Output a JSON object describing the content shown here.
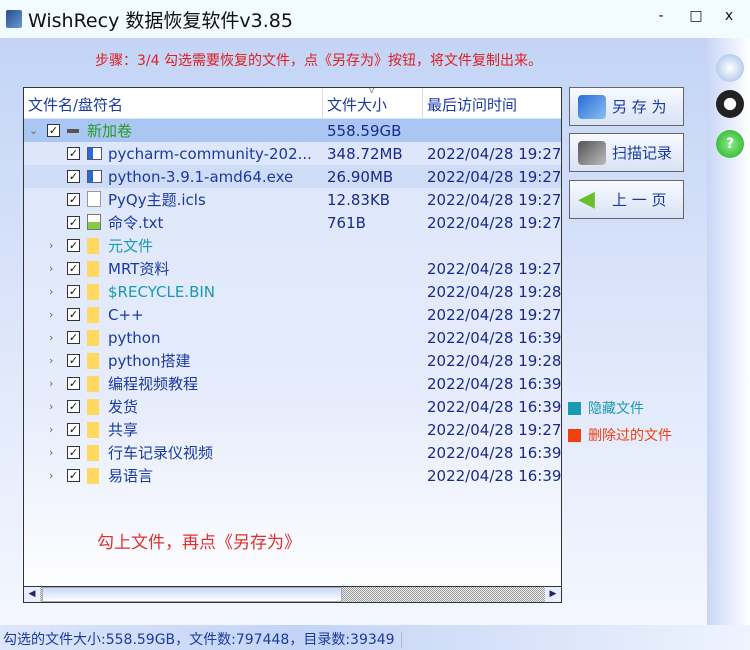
{
  "window": {
    "title": "WishRecy 数据恢复软件v3.85",
    "minimize": "-",
    "maximize": "□",
    "close": "x"
  },
  "step_text": "步骤：3/4 勾选需要恢复的文件，点《另存为》按钮，将文件复制出来。",
  "columns": {
    "name": "文件名/盘符名",
    "size": "文件大小",
    "time": "最后访问时间"
  },
  "rows": [
    {
      "name": "新加卷",
      "size": "558.59GB",
      "time": "",
      "level": 0,
      "type": "drive",
      "expanded": true,
      "checked": true,
      "color": "#2a9a2a"
    },
    {
      "name": "pycharm-community-202...",
      "size": "348.72MB",
      "time": "2022/04/28 19:27:",
      "level": 1,
      "type": "exe",
      "checked": true,
      "color": "#1a3aa0"
    },
    {
      "name": "python-3.9.1-amd64.exe",
      "size": "26.90MB",
      "time": "2022/04/28 19:27:",
      "level": 1,
      "type": "exe",
      "checked": true,
      "color": "#1a3aa0"
    },
    {
      "name": "PyQy主题.icls",
      "size": "12.83KB",
      "time": "2022/04/28 19:27:",
      "level": 1,
      "type": "file",
      "checked": true,
      "color": "#1a3aa0"
    },
    {
      "name": "命令.txt",
      "size": "761B",
      "time": "2022/04/28 19:27:",
      "level": 1,
      "type": "txt",
      "checked": true,
      "color": "#1a3aa0"
    },
    {
      "name": "元文件",
      "size": "",
      "time": "",
      "level": 1,
      "type": "folder",
      "checked": true,
      "color": "#1a9ab0"
    },
    {
      "name": "MRT资料",
      "size": "",
      "time": "2022/04/28 19:27:",
      "level": 1,
      "type": "folder",
      "checked": true,
      "color": "#1a3aa0"
    },
    {
      "name": "$RECYCLE.BIN",
      "size": "",
      "time": "2022/04/28 19:28:",
      "level": 1,
      "type": "folder",
      "checked": true,
      "color": "#1a9ab0"
    },
    {
      "name": "C++",
      "size": "",
      "time": "2022/04/28 19:27:",
      "level": 1,
      "type": "folder",
      "checked": true,
      "color": "#1a3aa0"
    },
    {
      "name": "python",
      "size": "",
      "time": "2022/04/28 16:39:",
      "level": 1,
      "type": "folder",
      "checked": true,
      "color": "#1a3aa0"
    },
    {
      "name": "python搭建",
      "size": "",
      "time": "2022/04/28 19:28:",
      "level": 1,
      "type": "folder",
      "checked": true,
      "color": "#1a3aa0"
    },
    {
      "name": "编程视频教程",
      "size": "",
      "time": "2022/04/28 16:39:",
      "level": 1,
      "type": "folder",
      "checked": true,
      "color": "#1a3aa0"
    },
    {
      "name": "发货",
      "size": "",
      "time": "2022/04/28 16:39:",
      "level": 1,
      "type": "folder",
      "checked": true,
      "color": "#1a3aa0"
    },
    {
      "name": "共享",
      "size": "",
      "time": "2022/04/28 19:27:",
      "level": 1,
      "type": "folder",
      "checked": true,
      "color": "#1a3aa0"
    },
    {
      "name": "行车记录仪视频",
      "size": "",
      "time": "2022/04/28 16:39:",
      "level": 1,
      "type": "folder",
      "checked": true,
      "color": "#1a3aa0"
    },
    {
      "name": "易语言",
      "size": "",
      "time": "2022/04/28 16:39:",
      "level": 1,
      "type": "folder",
      "checked": true,
      "color": "#1a3aa0"
    }
  ],
  "hint": "勾上文件，再点《另存为》",
  "buttons": {
    "save_as": "另 存 为",
    "scan_log": "扫描记录",
    "prev": "上 一 页"
  },
  "legend": [
    {
      "label": "隐藏文件",
      "color": "#1a9ab0"
    },
    {
      "label": "删除过的文件",
      "color": "#f04010"
    }
  ],
  "status": "勾选的文件大小:558.59GB，文件数:797448，目录数:39349"
}
